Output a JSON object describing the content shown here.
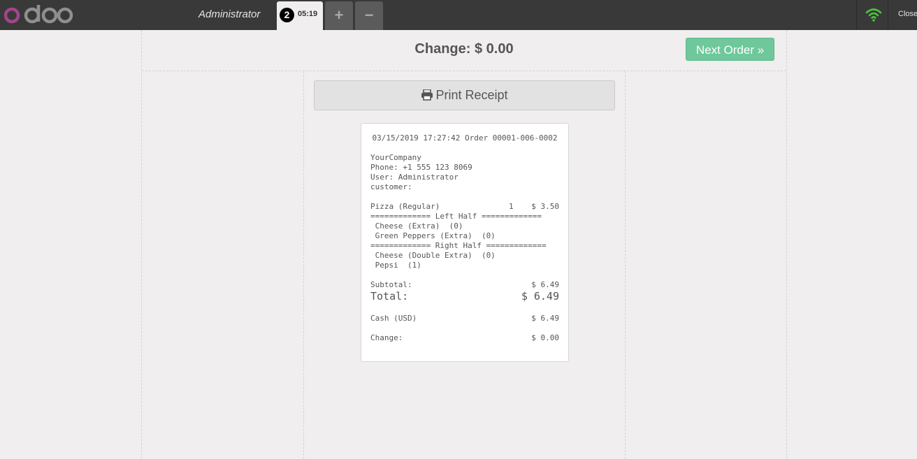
{
  "topbar": {
    "cashier": "Administrator",
    "order_tab": {
      "sequence": "2",
      "time": "05:19"
    },
    "add_label": "+",
    "remove_label": "−",
    "close_label": "Close",
    "wifi_color": "#4ac43a"
  },
  "header": {
    "change_text": "Change: $ 0.00",
    "next_order_label": "Next Order »"
  },
  "print_button_label": "Print Receipt",
  "receipt": {
    "header": "03/15/2019 17:27:42 Order 00001-006-0002",
    "company": "YourCompany",
    "phone": "Phone: +1 555 123 8069",
    "user": "User: Administrator",
    "customer": "customer:",
    "product_name": "Pizza (Regular)",
    "product_qty": "1",
    "product_price": "$ 3.50",
    "lines": [
      "============= Left Half =============",
      " Cheese (Extra)  (0)",
      " Green Peppers (Extra)  (0)",
      "============= Right Half =============",
      " Cheese (Double Extra)  (0)",
      " Pepsi  (1)"
    ],
    "subtotal_label": "Subtotal:",
    "subtotal_value": "$ 6.49",
    "total_label": "Total:",
    "total_value": "$ 6.49",
    "payment_label": "Cash (USD)",
    "payment_value": "$ 6.49",
    "change_label": "Change:",
    "change_value": "$ 0.00"
  }
}
